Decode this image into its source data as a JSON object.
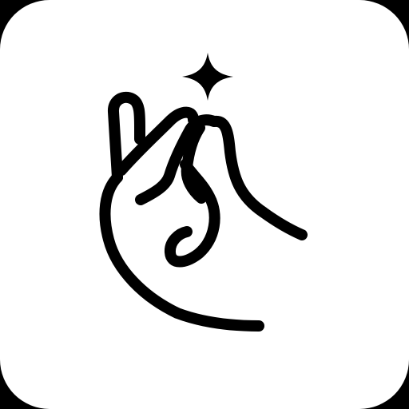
{
  "app_icon": {
    "icon": "finger-snap-icon",
    "accent": "sparkle-icon",
    "colors": {
      "background": "#000000",
      "tile": "#ffffff",
      "glyph": "#000000"
    }
  }
}
